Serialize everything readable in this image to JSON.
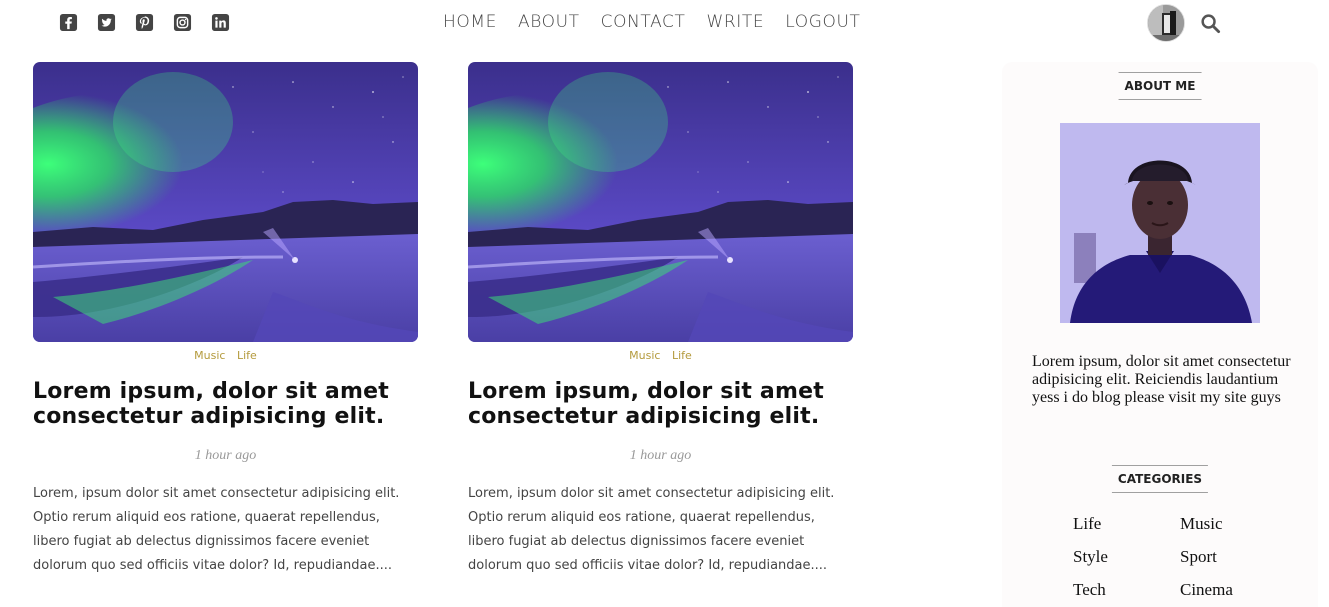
{
  "social": {
    "icons": [
      "facebook-square-icon",
      "twitter-square-icon",
      "pinterest-square-icon",
      "instagram-square-icon",
      "linkedin-square-icon"
    ]
  },
  "nav": {
    "items": [
      "HOME",
      "ABOUT",
      "CONTACT",
      "WRITE",
      "LOGOUT"
    ]
  },
  "posts": [
    {
      "categories": [
        "Music",
        "Life"
      ],
      "title": "Lorem ipsum, dolor sit amet consectetur adipisicing elit.",
      "time": "1 hour ago",
      "description": "Lorem, ipsum dolor sit amet consectetur adipisicing elit. Optio rerum aliquid eos ratione, quaerat repellendus, libero fugiat ab delectus dignissimos facere eveniet dolorum quo sed officiis vitae dolor? Id, repudiandae...."
    },
    {
      "categories": [
        "Music",
        "Life"
      ],
      "title": "Lorem ipsum, dolor sit amet consectetur adipisicing elit.",
      "time": "1 hour ago",
      "description": "Lorem, ipsum dolor sit amet consectetur adipisicing elit. Optio rerum aliquid eos ratione, quaerat repellendus, libero fugiat ab delectus dignissimos facere eveniet dolorum quo sed officiis vitae dolor? Id, repudiandae...."
    }
  ],
  "sidebar": {
    "about_heading": "ABOUT ME",
    "about_text": "Lorem ipsum, dolor sit amet consectetur adipisicing elit. Reiciendis laudantium yess i do blog please visit my site guys",
    "categories_heading": "CATEGORIES",
    "categories": [
      "Life",
      "Music",
      "Style",
      "Sport",
      "Tech",
      "Cinema"
    ]
  },
  "colors": {
    "category_accent": "#b49a3c",
    "nav_text": "#444444",
    "sidebar_bg": "#fdfbfb"
  }
}
